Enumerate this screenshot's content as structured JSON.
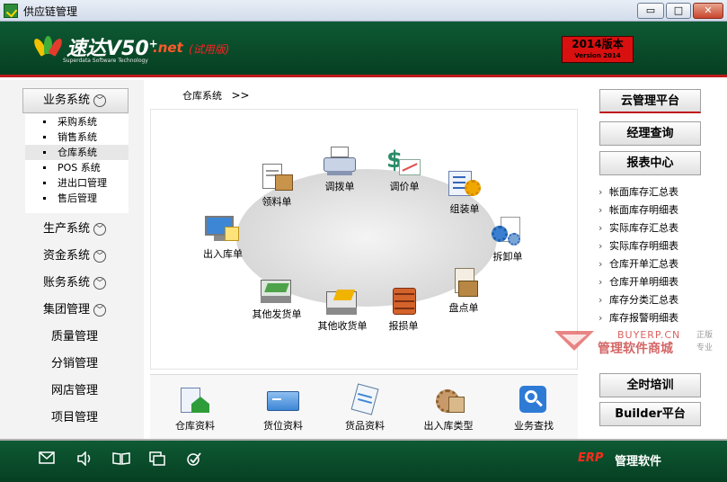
{
  "window": {
    "title": "供应链管理",
    "min_label": "▭",
    "max_label": "□",
    "close_label": "✕"
  },
  "banner": {
    "product": "速达V50",
    "plus": "+",
    "net": ".net",
    "trial": "(试用版)",
    "subtitle": "Superdata Software Technology",
    "version_main": "2014版本",
    "version_sub": "Version 2014"
  },
  "leftnav": {
    "header": "业务系统",
    "sub_items": [
      "采购系统",
      "销售系统",
      "仓库系统",
      "POS 系统",
      "进出口管理",
      "售后管理"
    ],
    "active_sub": 2,
    "items": [
      {
        "label": "生产系统",
        "chevron": true
      },
      {
        "label": "资金系统",
        "chevron": true
      },
      {
        "label": "账务系统",
        "chevron": true
      },
      {
        "label": "集团管理",
        "chevron": true
      },
      {
        "label": "质量管理",
        "chevron": false
      },
      {
        "label": "分销管理",
        "chevron": false
      },
      {
        "label": "网店管理",
        "chevron": false
      },
      {
        "label": "项目管理",
        "chevron": false
      }
    ]
  },
  "breadcrumb": {
    "text": "仓库系统",
    "arrow": ">>"
  },
  "flow_items": [
    {
      "label": "领料单",
      "icon": "requisition-icon"
    },
    {
      "label": "调拨单",
      "icon": "transfer-icon"
    },
    {
      "label": "调价单",
      "icon": "price-adjust-icon"
    },
    {
      "label": "组装单",
      "icon": "assembly-icon"
    },
    {
      "label": "出入库单",
      "icon": "in-out-stock-icon"
    },
    {
      "label": "拆卸单",
      "icon": "disassembly-icon"
    },
    {
      "label": "其他发货单",
      "icon": "other-shipment-icon"
    },
    {
      "label": "其他收货单",
      "icon": "other-receipt-icon"
    },
    {
      "label": "报损单",
      "icon": "loss-report-icon"
    },
    {
      "label": "盘点单",
      "icon": "stocktake-icon"
    }
  ],
  "bottom_items": [
    {
      "label": "仓库资料",
      "icon": "warehouse-info-icon"
    },
    {
      "label": "货位资料",
      "icon": "location-info-icon"
    },
    {
      "label": "货品资料",
      "icon": "goods-info-icon"
    },
    {
      "label": "出入库类型",
      "icon": "in-out-type-icon"
    },
    {
      "label": "业务查找",
      "icon": "search-icon"
    }
  ],
  "right": {
    "buttons_top": [
      "云管理平台",
      "经理查询",
      "报表中心"
    ],
    "reports": [
      "帐面库存汇总表",
      "帐面库存明细表",
      "实际库存汇总表",
      "实际库存明细表",
      "仓库开单汇总表",
      "仓库开单明细表",
      "库存分类汇总表",
      "库存报警明细表"
    ],
    "buttons_bottom": [
      "全时培训",
      "Builder平台"
    ]
  },
  "watermark": {
    "url": "BUYERP.CN",
    "name": "管理软件商城",
    "side": "正版专业"
  },
  "statusbar": {
    "icons": [
      "mail-icon",
      "speaker-icon",
      "book-icon",
      "windows-icon",
      "check-icon"
    ],
    "erp": "ERP",
    "erp_tail": "管理软件"
  },
  "colors": {
    "header_green": "#0e5a34",
    "accent_red": "#c01818",
    "version_red": "#d81010"
  }
}
